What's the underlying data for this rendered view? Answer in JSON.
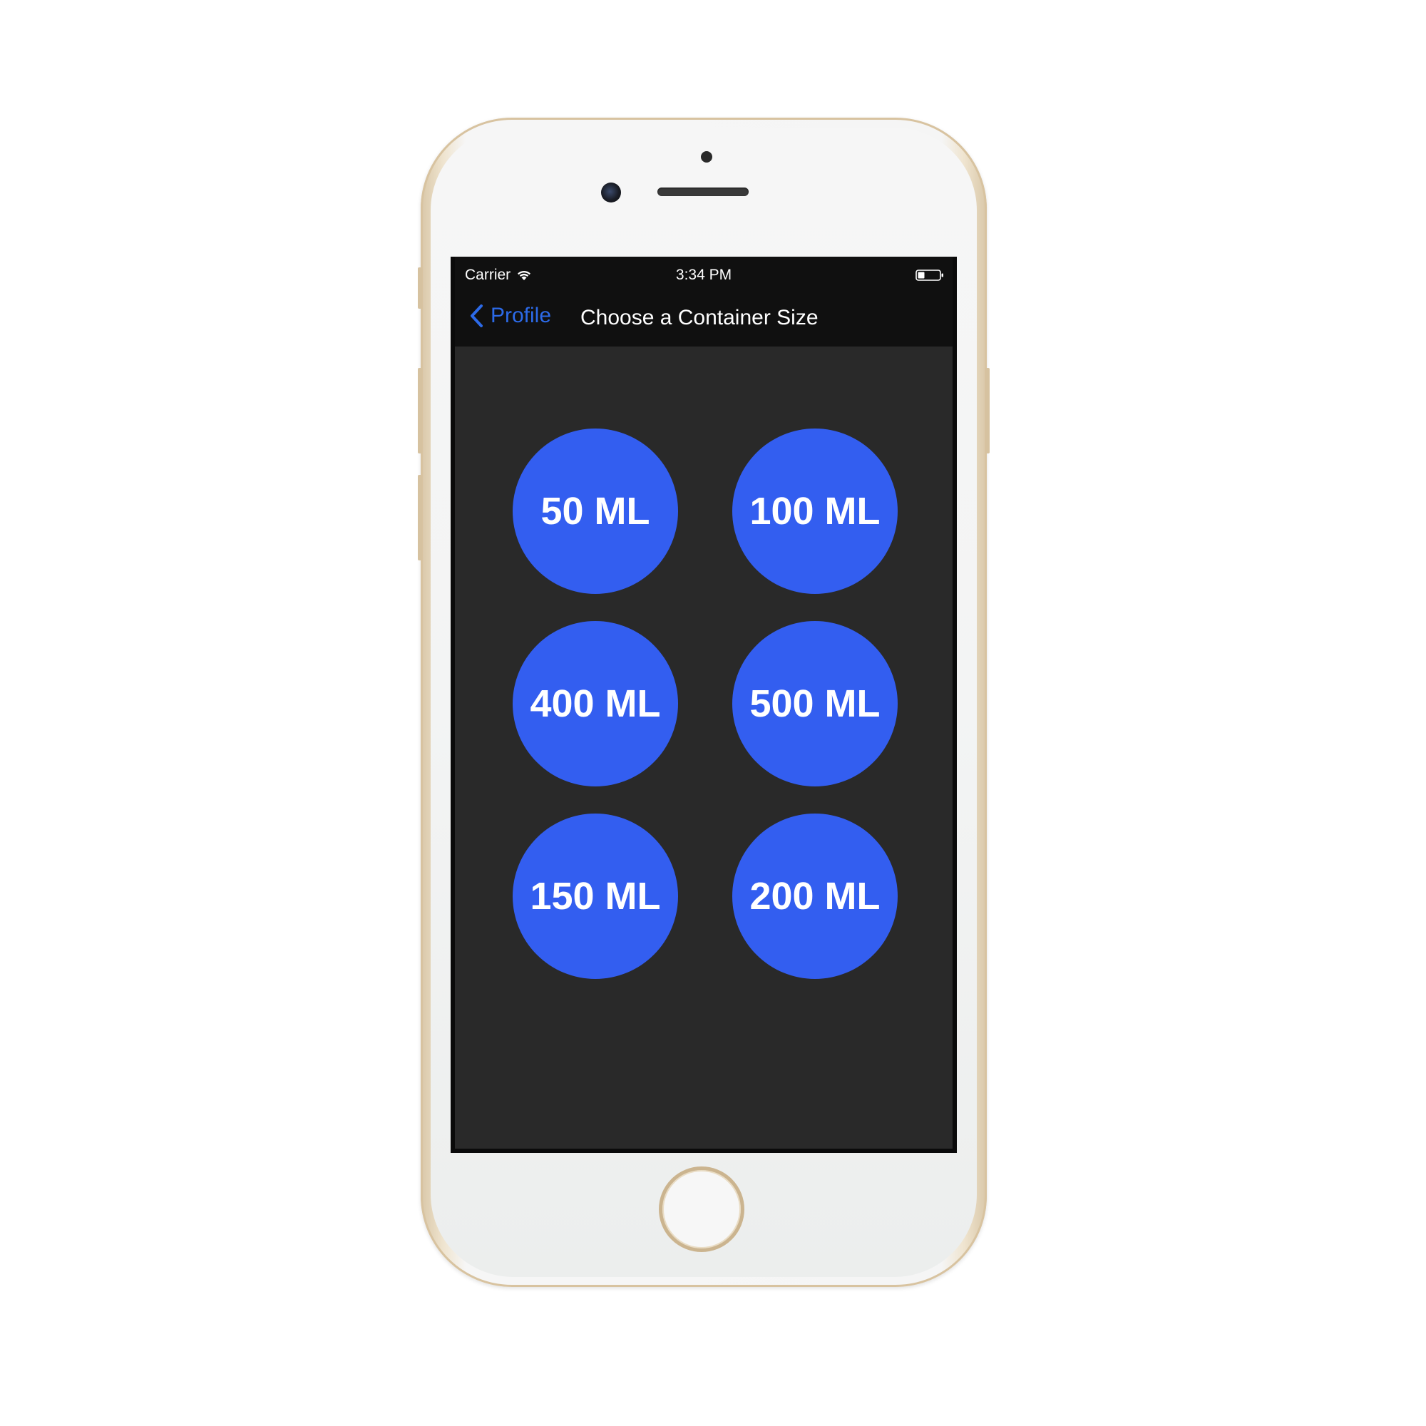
{
  "status_bar": {
    "carrier": "Carrier",
    "time": "3:34 PM",
    "icons": [
      "wifi-icon",
      "battery-icon"
    ]
  },
  "nav_bar": {
    "back_label": "Profile",
    "back_icon": "chevron-left-icon",
    "title": "Choose a Container Size"
  },
  "sizes": [
    {
      "label": "50 ML"
    },
    {
      "label": "100 ML"
    },
    {
      "label": "400 ML"
    },
    {
      "label": "500 ML"
    },
    {
      "label": "150 ML"
    },
    {
      "label": "200 ML"
    }
  ],
  "colors": {
    "accent": "#2c6ae8",
    "button_fill": "#335ef0",
    "background": "#292929",
    "bar_background": "#101010"
  }
}
